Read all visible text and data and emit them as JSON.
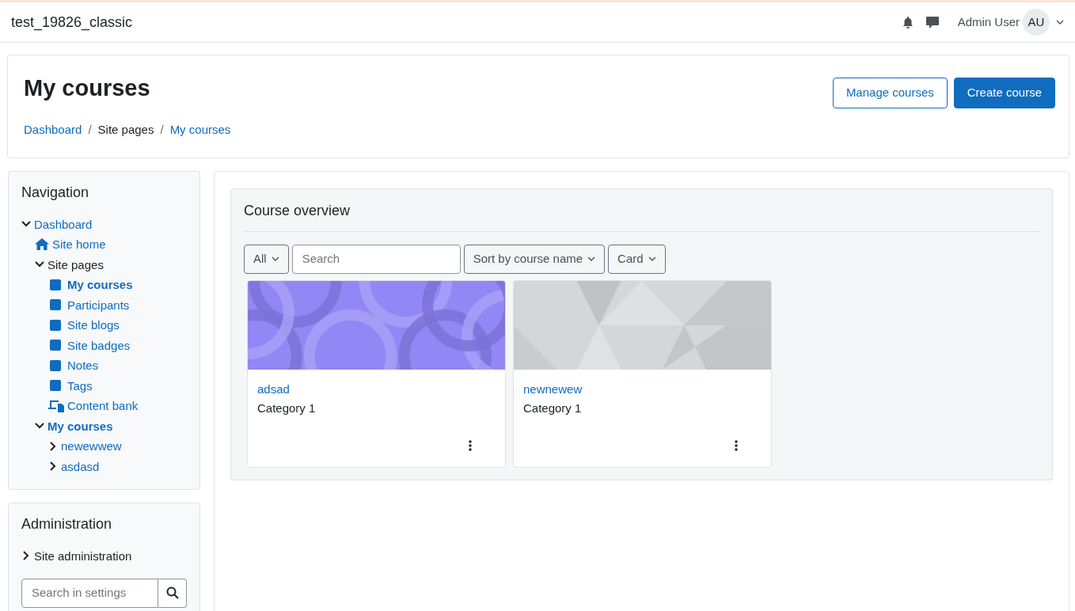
{
  "navbar": {
    "site_name": "test_19826_classic",
    "user_name": "Admin User",
    "avatar_initials": "AU"
  },
  "header": {
    "title": "My courses",
    "buttons": [
      {
        "label": "Manage courses",
        "kind": "outline"
      },
      {
        "label": "Create course",
        "kind": "primary"
      }
    ],
    "breadcrumb_separator": "/",
    "breadcrumb": [
      {
        "label": "Dashboard",
        "link": true
      },
      {
        "label": "Site pages",
        "link": false
      },
      {
        "label": "My courses",
        "link": true
      }
    ]
  },
  "navigation": {
    "title": "Navigation",
    "items": [
      {
        "label": "Dashboard",
        "kind": "branch",
        "link": true,
        "current": false,
        "expanded": true,
        "children": [
          {
            "label": "Site home",
            "kind": "home",
            "link": true,
            "current": false
          },
          {
            "label": "Site pages",
            "kind": "branch",
            "link": false,
            "current": false,
            "expanded": true,
            "children": [
              {
                "label": "My courses",
                "kind": "page",
                "link": true,
                "current": true
              },
              {
                "label": "Participants",
                "kind": "page",
                "link": true,
                "current": false
              },
              {
                "label": "Site blogs",
                "kind": "page",
                "link": true,
                "current": false
              },
              {
                "label": "Site badges",
                "kind": "page",
                "link": true,
                "current": false
              },
              {
                "label": "Notes",
                "kind": "page",
                "link": true,
                "current": false
              },
              {
                "label": "Tags",
                "kind": "page",
                "link": true,
                "current": false
              },
              {
                "label": "Content bank",
                "kind": "bank",
                "link": true,
                "current": false
              }
            ]
          },
          {
            "label": "My courses",
            "kind": "branch",
            "link": true,
            "current": true,
            "expanded": true,
            "children": [
              {
                "label": "newewwew",
                "kind": "branch",
                "link": true,
                "current": false,
                "expanded": false
              },
              {
                "label": "asdasd",
                "kind": "branch",
                "link": true,
                "current": false,
                "expanded": false
              }
            ]
          }
        ]
      }
    ]
  },
  "administration": {
    "title": "Administration",
    "items": [
      {
        "label": "Site administration",
        "kind": "branch",
        "link": false,
        "current": false,
        "expanded": false
      }
    ],
    "search": {
      "placeholder": "Search in settings"
    }
  },
  "course_overview": {
    "title": "Course overview",
    "filters": [
      {
        "label": "All",
        "kind": "dropdown"
      },
      {
        "placeholder": "Search",
        "kind": "search"
      },
      {
        "label": "Sort by course name",
        "kind": "dropdown"
      },
      {
        "label": "Card",
        "kind": "dropdown"
      }
    ],
    "courses": [
      {
        "name": "adsad",
        "category": "Category 1",
        "kind": "circles"
      },
      {
        "name": "newnewew",
        "category": "Category 1",
        "kind": "triangles"
      }
    ]
  }
}
